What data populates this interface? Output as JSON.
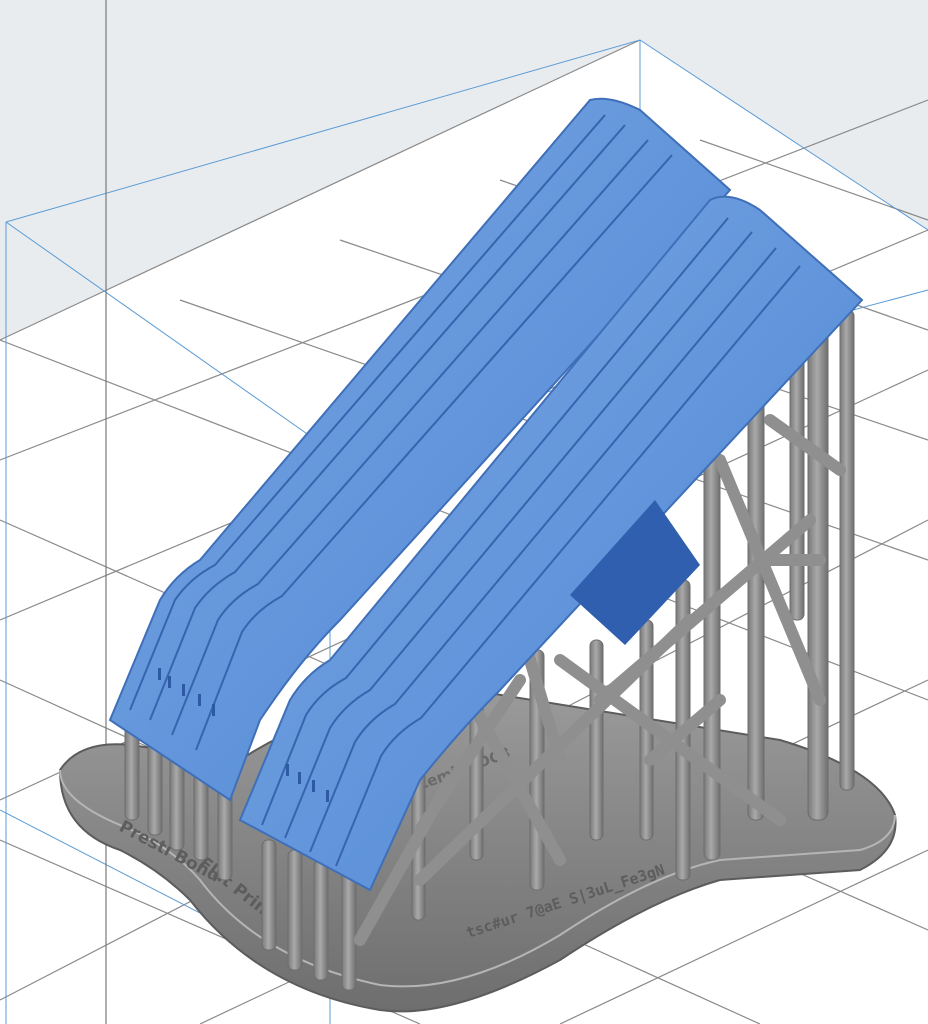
{
  "viewport": {
    "kind": "3D print preparation viewport",
    "background_upper": "#e8ecef",
    "background_floor": "#ffffff",
    "grid_color": "#8a8a8a",
    "bounding_box_color": "#5b9bd5"
  },
  "model": {
    "name_icon": "dental-splint-model",
    "parts": 2,
    "part_color": "#5b8fd6",
    "part_dark_color": "#2f5fae",
    "support_color": "#8c8c8c",
    "raft_color": "#8f8f8f"
  },
  "raft_labels": [
    "Presti Bond",
    "Flat Print",
    "tsc#ur 7@aE S|3uL_Fe3gN",
    "Lemir 8DC3"
  ]
}
